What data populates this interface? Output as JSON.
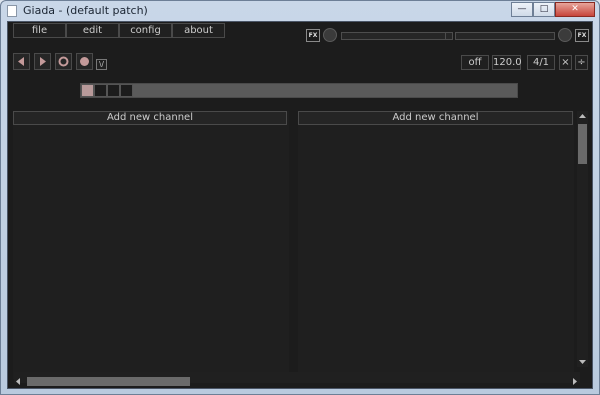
{
  "window": {
    "title": "Giada - (default patch)"
  },
  "menu": {
    "items": [
      "file",
      "edit",
      "config",
      "about"
    ]
  },
  "transport": {
    "metronome_label": "\\/"
  },
  "tempo": {
    "quantize": "off",
    "bpm": "120.0",
    "beats": "4/1"
  },
  "controls": {
    "fx_in_label": "FX",
    "fx_out_label": "FX",
    "reset_label": "×",
    "divide_label": "÷"
  },
  "columns": {
    "add_channel_label": "Add new channel"
  }
}
